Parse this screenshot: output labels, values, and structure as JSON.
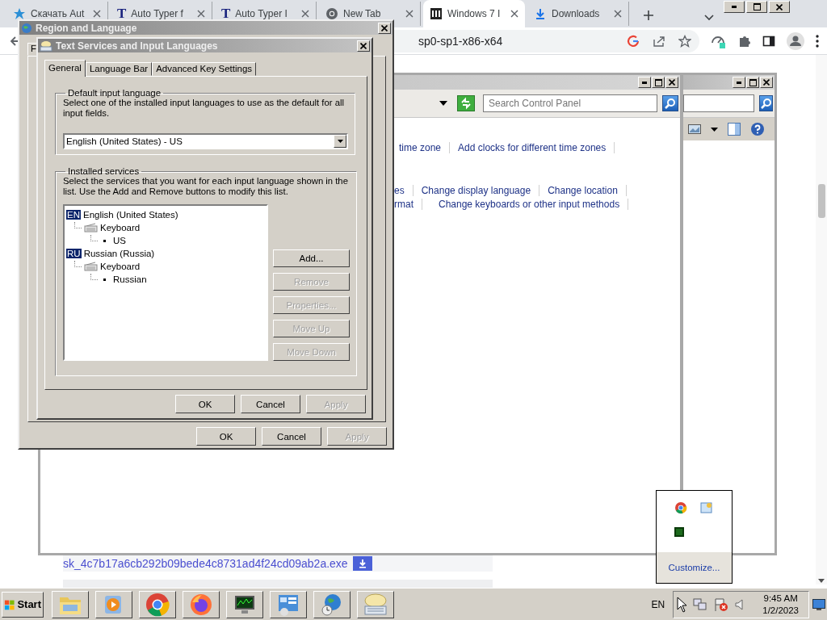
{
  "browser": {
    "tabs": [
      {
        "kind": "site",
        "title": "Скачать Aut",
        "selected": false
      },
      {
        "kind": "typer",
        "icon_text": "T",
        "title": "Auto Typer f",
        "selected": false
      },
      {
        "kind": "typer",
        "icon_text": "T",
        "title": "Auto Typer I",
        "selected": false
      },
      {
        "kind": "chrome",
        "title": "New Tab",
        "selected": false
      },
      {
        "kind": "windows",
        "title": "Windows 7 I",
        "selected": true
      },
      {
        "kind": "download",
        "title": "Downloads",
        "selected": false
      }
    ],
    "url": "sp0-sp1-x86-x64"
  },
  "control_panel": {
    "search": {
      "placeholder": "Search Control Panel"
    },
    "link_rows": [
      {
        "links": [
          "time zone",
          "Add clocks for different time zones"
        ]
      },
      {
        "links": [
          "es",
          "Change display language",
          "Change location"
        ]
      },
      {
        "links": [
          "rmat",
          "Change keyboards or other input methods"
        ]
      }
    ]
  },
  "download_bar": {
    "file": "sk_4c7b17a6cb292b09bede4c8731ad4f24cd09ab2a.exe"
  },
  "region_dialog": {
    "title": "Region and Language",
    "tab": "F",
    "buttons": [
      {
        "label": "OK",
        "disabled": false
      },
      {
        "label": "Cancel",
        "disabled": false
      },
      {
        "label": "Apply",
        "disabled": true
      }
    ]
  },
  "text_services_dialog": {
    "title": "Text Services and Input Languages",
    "tabs": [
      {
        "label": "General",
        "selected": true
      },
      {
        "label": "Language Bar",
        "selected": false
      },
      {
        "label": "Advanced Key Settings",
        "selected": false
      }
    ],
    "default_group": {
      "legend": "Default input language",
      "description": "Select one of the installed input languages to use as the default for all input fields.",
      "value": "English (United States) - US"
    },
    "services_group": {
      "legend": "Installed services",
      "description": "Select the services that you want for each input language shown in the list. Use the Add and Remove buttons to modify this list.",
      "tree": [
        {
          "code": "EN",
          "label": "English (United States)",
          "children": [
            {
              "label": "Keyboard",
              "children": [
                {
                  "label": "US"
                }
              ]
            }
          ]
        },
        {
          "code": "RU",
          "label": "Russian (Russia)",
          "children": [
            {
              "label": "Keyboard",
              "children": [
                {
                  "label": "Russian"
                }
              ]
            }
          ]
        }
      ],
      "buttons": [
        {
          "label": "Add...",
          "disabled": false
        },
        {
          "label": "Remove",
          "disabled": true
        },
        {
          "label": "Properties...",
          "disabled": true
        },
        {
          "label": "Move Up",
          "disabled": true
        },
        {
          "label": "Move Down",
          "disabled": true
        }
      ]
    },
    "buttons": [
      {
        "label": "OK",
        "disabled": false
      },
      {
        "label": "Cancel",
        "disabled": false
      },
      {
        "label": "Apply",
        "disabled": true
      }
    ]
  },
  "tray_popup": {
    "link": "Customize..."
  },
  "taskbar": {
    "start": "Start",
    "apps": [
      {
        "kind": "folder"
      },
      {
        "kind": "media"
      },
      {
        "kind": "chrome"
      },
      {
        "kind": "firefox"
      },
      {
        "kind": "monitor"
      },
      {
        "kind": "panel"
      },
      {
        "kind": "globe"
      },
      {
        "kind": "keyboard"
      }
    ],
    "language": "EN",
    "time": "9:45 AM",
    "date": "1/2/2023"
  }
}
